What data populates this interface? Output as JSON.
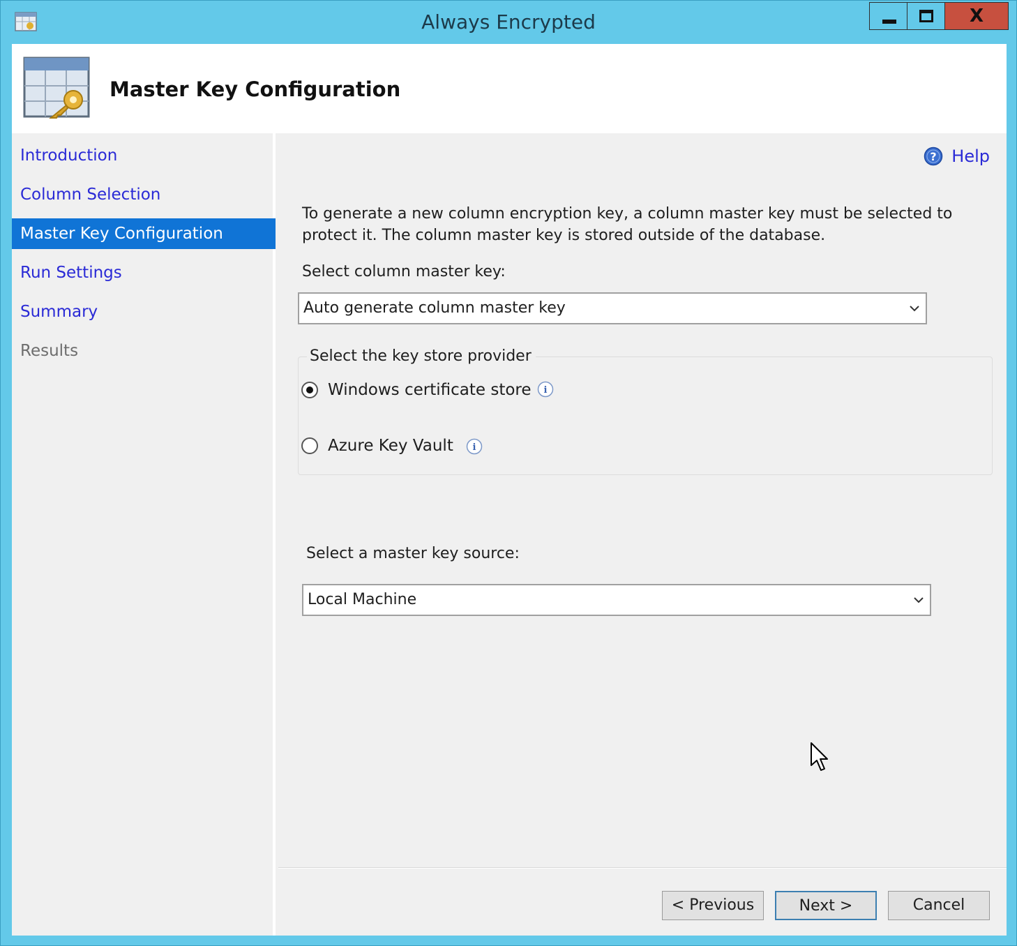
{
  "window": {
    "title": "Always Encrypted",
    "controls": {
      "minimize": "minimize",
      "maximize": "maximize",
      "close": "X"
    }
  },
  "header": {
    "title": "Master Key Configuration",
    "icon": "table-key-icon"
  },
  "sidebar": {
    "items": [
      {
        "label": "Introduction",
        "state": "link"
      },
      {
        "label": "Column Selection",
        "state": "link"
      },
      {
        "label": "Master Key Configuration",
        "state": "active"
      },
      {
        "label": "Run Settings",
        "state": "link"
      },
      {
        "label": "Summary",
        "state": "link"
      },
      {
        "label": "Results",
        "state": "disabled"
      }
    ]
  },
  "main": {
    "help_label": "Help",
    "intro_text": "To generate a new column encryption key, a column master key must be selected to protect it.  The column master key is stored outside of the database.",
    "master_key": {
      "label": "Select column master key:",
      "value": "Auto generate column master key"
    },
    "key_store": {
      "legend": "Select the key store provider",
      "options": [
        {
          "label": "Windows certificate store",
          "checked": true
        },
        {
          "label": "Azure Key Vault",
          "checked": false
        }
      ]
    },
    "key_source": {
      "label": "Select a master key source:",
      "value": "Local Machine"
    }
  },
  "footer": {
    "previous_label": "< Previous",
    "next_label": "Next >",
    "cancel_label": "Cancel"
  },
  "colors": {
    "titlebar": "#63c9e9",
    "close_button": "#c7503f",
    "selection": "#1074d6",
    "link": "#2a2ad6"
  }
}
